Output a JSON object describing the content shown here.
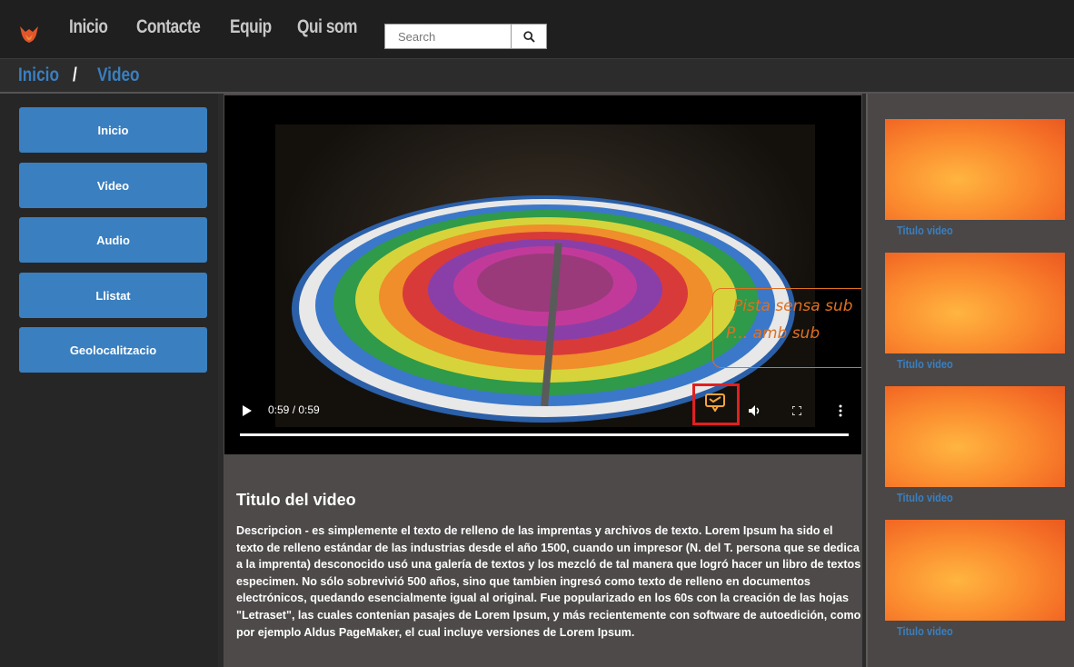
{
  "nav": {
    "items": [
      "Inicio",
      "Contacte",
      "Equip",
      "Qui som"
    ],
    "search_placeholder": "Search"
  },
  "breadcrumb": {
    "home": "Inicio",
    "separator": "/",
    "current": "Video"
  },
  "sidebar": {
    "items": [
      "Inicio",
      "Video",
      "Audio",
      "Llistat",
      "Geolocalitzacio"
    ]
  },
  "player": {
    "time": "0:59 / 0:59",
    "progress": 1.0,
    "annotation_line1": "Pista sensa sub",
    "annotation_line2": "P... amb sub"
  },
  "video": {
    "title": "Titulo del video",
    "description": "Descripcion - es simplemente el texto de relleno de las imprentas y archivos de texto. Lorem Ipsum ha sido el texto de relleno estándar de las industrias desde el año 1500, cuando un impresor (N. del T. persona que se dedica a la imprenta) desconocido usó una galería de textos y los mezcló de tal manera que logró hacer un libro de textos especimen. No sólo sobrevivió 500 años, sino que tambien ingresó como texto de relleno en documentos electrónicos, quedando esencialmente igual al original. Fue popularizado en los 60s con la creación de las hojas \"Letraset\", las cuales contenian pasajes de Lorem Ipsum, y más recientemente con software de autoedición, como por ejemplo Aldus PageMaker, el cual incluye versiones de Lorem Ipsum."
  },
  "related": {
    "items": [
      "Titulo video",
      "Titulo video",
      "Titulo video",
      "Titulo video"
    ]
  },
  "colors": {
    "accent": "#3a7fc0",
    "annotation": "#e07020",
    "highlight": "#e02020"
  }
}
